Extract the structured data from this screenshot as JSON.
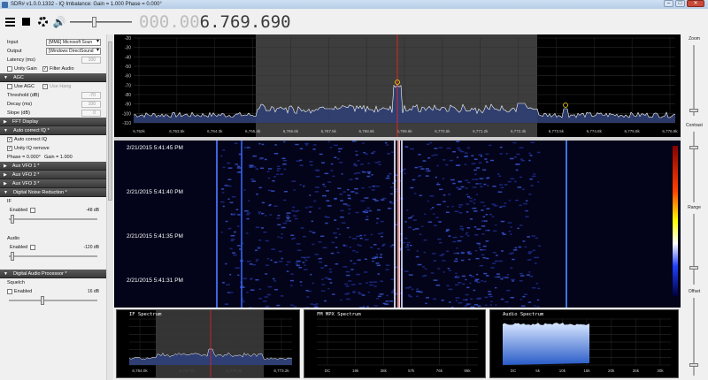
{
  "window": {
    "title": "SDR# v1.0.0.1332 - IQ Imbalance: Gain = 1.000 Phase = 0.000°",
    "buttons": {
      "minimize": "–",
      "maximize": "□",
      "close": "✕"
    }
  },
  "toolbar": {
    "icons": [
      "menu-icon",
      "stop-icon",
      "gear-icon",
      "speaker-icon"
    ],
    "volume_level": 0.38,
    "frequency_dim": "000.00",
    "frequency_bright": "6.769.690"
  },
  "left_panel": {
    "input_label": "Input",
    "input_value": "[MME] Microsoft Soun",
    "output_label": "Output",
    "output_value": "[Windows DirectSound",
    "latency_label": "Latency (ms)",
    "latency_value": "100",
    "unity_gain_label": "Unity Gain",
    "filter_audio_label": "Filter Audio",
    "agc_header": "AGC",
    "use_agc_label": "Use AGC",
    "use_hang_label": "Use Hang",
    "threshold_label": "Threshold (dB)",
    "threshold_value": "-70",
    "decay_label": "Decay (ms)",
    "decay_value": "100",
    "slope_label": "Slope (dB)",
    "slope_value": "0",
    "fft_display_header": "FFT Display",
    "auto_correct_header": "Auto correct IQ *",
    "auto_correct_iq_label": "Auto correct IQ",
    "unity_iq_label": "Unity IQ remove",
    "phase_label": "Phase = 0.000°",
    "gain_label": "Gain = 1.000",
    "aux_vfo_1": "Aux VFO 1 *",
    "aux_vfo_2": "Aux VFO 2 *",
    "aux_vfo_3": "Aux VFO 3 *",
    "dnr_header": "Digital Noise Reduction *",
    "if_label": "IF",
    "if_enabled_label": "Enabled",
    "if_value": "-48 dB",
    "audio_label": "Audio",
    "audio_enabled_label": "Enabled",
    "audio_value": "-120 dB",
    "dap_header": "Digital Audio Processor *",
    "squelch_label": "Squelch",
    "squelch_enabled_label": "Enabled",
    "squelch_value": "16 dB"
  },
  "spectrum": {
    "y_ticks": [
      "-20",
      "-30",
      "-40",
      "-50",
      "-60",
      "-70",
      "-80",
      "-90",
      "-100",
      "-110"
    ],
    "x_ticks": [
      "6,762k",
      "6,763.5k",
      "6,764.3k",
      "6,765.4k",
      "6,766.6k",
      "6,767.5k",
      "6,768.6k",
      "6,769.6k",
      "6,770.5k",
      "6,771.2k",
      "6,772.3k",
      "6,773.5k",
      "6,774.8k",
      "6,775.8k",
      "6,776.9k"
    ]
  },
  "waterfall": {
    "timestamps": [
      "2/21/2015 5:41:45 PM",
      "2/21/2015 5:41:40 PM",
      "2/21/2015 5:41:35 PM",
      "2/21/2015 5:41:31 PM"
    ]
  },
  "right_panel": {
    "zoom_label": "Zoom",
    "contrast_label": "Contrast",
    "range_label": "Range",
    "offset_label": "Offset"
  },
  "bottom_panels": {
    "if_title": "IF Spectrum",
    "if_ticks": [
      "6,764.0k",
      "6,767.5k",
      "6,770.4k",
      "6,773.2k"
    ],
    "fm_title": "FM MPX Spectrum",
    "fm_ticks": [
      "DC",
      "19k",
      "38k",
      "57k",
      "76k",
      "95k"
    ],
    "audio_title": "Audio Spectrum",
    "audio_ticks": [
      "DC",
      "5k",
      "10k",
      "15k",
      "20k",
      "25k",
      "30k"
    ]
  },
  "colors": {
    "spectrum_fill": "#2f3f73",
    "spectrum_line": "#ffffff",
    "tuning_line": "#ff2222",
    "waterfall_bg": "#03031a",
    "panel_header": "#444444"
  }
}
